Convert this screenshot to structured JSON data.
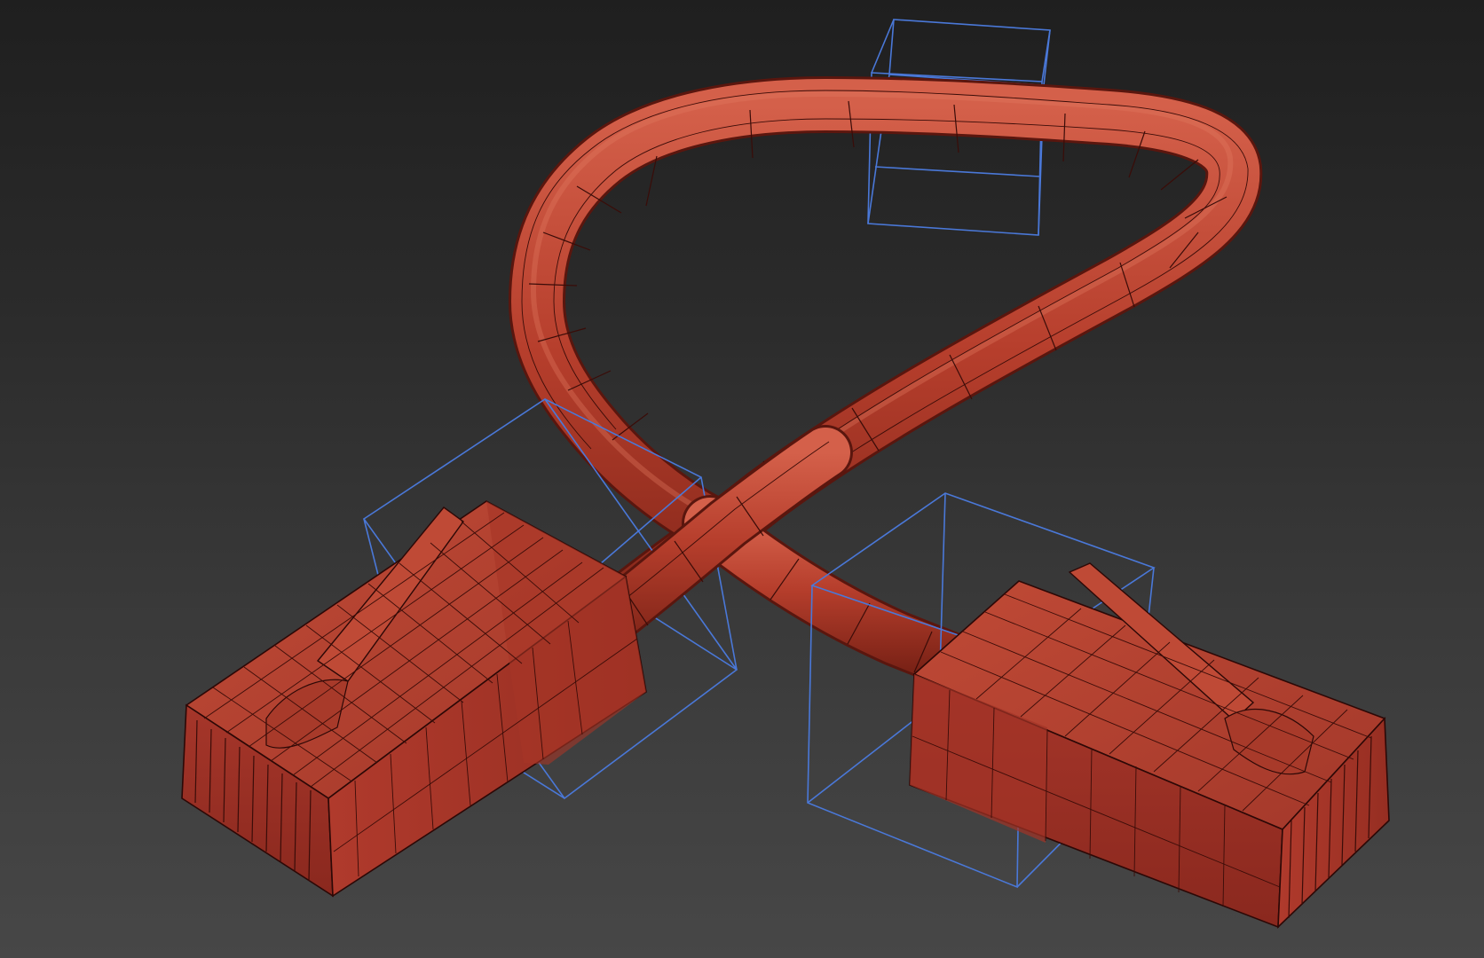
{
  "viewport": {
    "name": "3d-viewport",
    "background_top": "#1f1f1f",
    "background_bottom": "#474747"
  },
  "model": {
    "object": "cable-with-two-connectors",
    "render_mode": "shaded-with-wireframe",
    "material_color": "#b03a2a",
    "wire_color": "#3a0c08"
  },
  "selection": {
    "gizmo_color": "#4a78d8",
    "bounding_boxes": [
      "top-box",
      "left-connector-box",
      "right-connector-box"
    ]
  }
}
